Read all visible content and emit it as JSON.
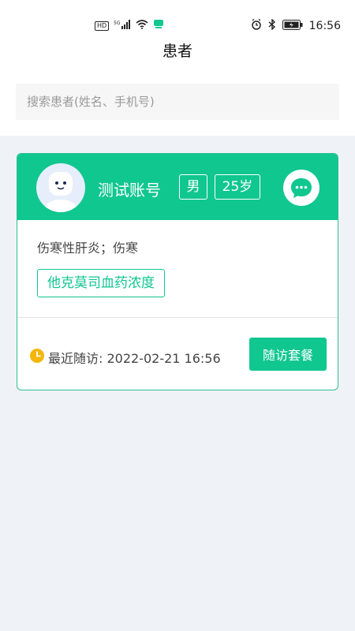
{
  "status_bar": {
    "network_badge": "HD",
    "signal_label": "5G",
    "time": "16:56"
  },
  "navbar": {
    "title": "患者"
  },
  "search": {
    "placeholder": "搜索患者(姓名、手机号)",
    "value": ""
  },
  "patient_card": {
    "name": "测试账号",
    "gender": "男",
    "age": "25岁",
    "diagnosis": "伤寒性肝炎；伤寒",
    "drug_tag": "他克莫司血药浓度",
    "last_visit_label": "最近随访: 2022-02-21 16:56",
    "package_button": "随访套餐"
  },
  "colors": {
    "primary": "#10c790",
    "page_bg": "#eff2f7",
    "clock_icon": "#f5b50a"
  }
}
